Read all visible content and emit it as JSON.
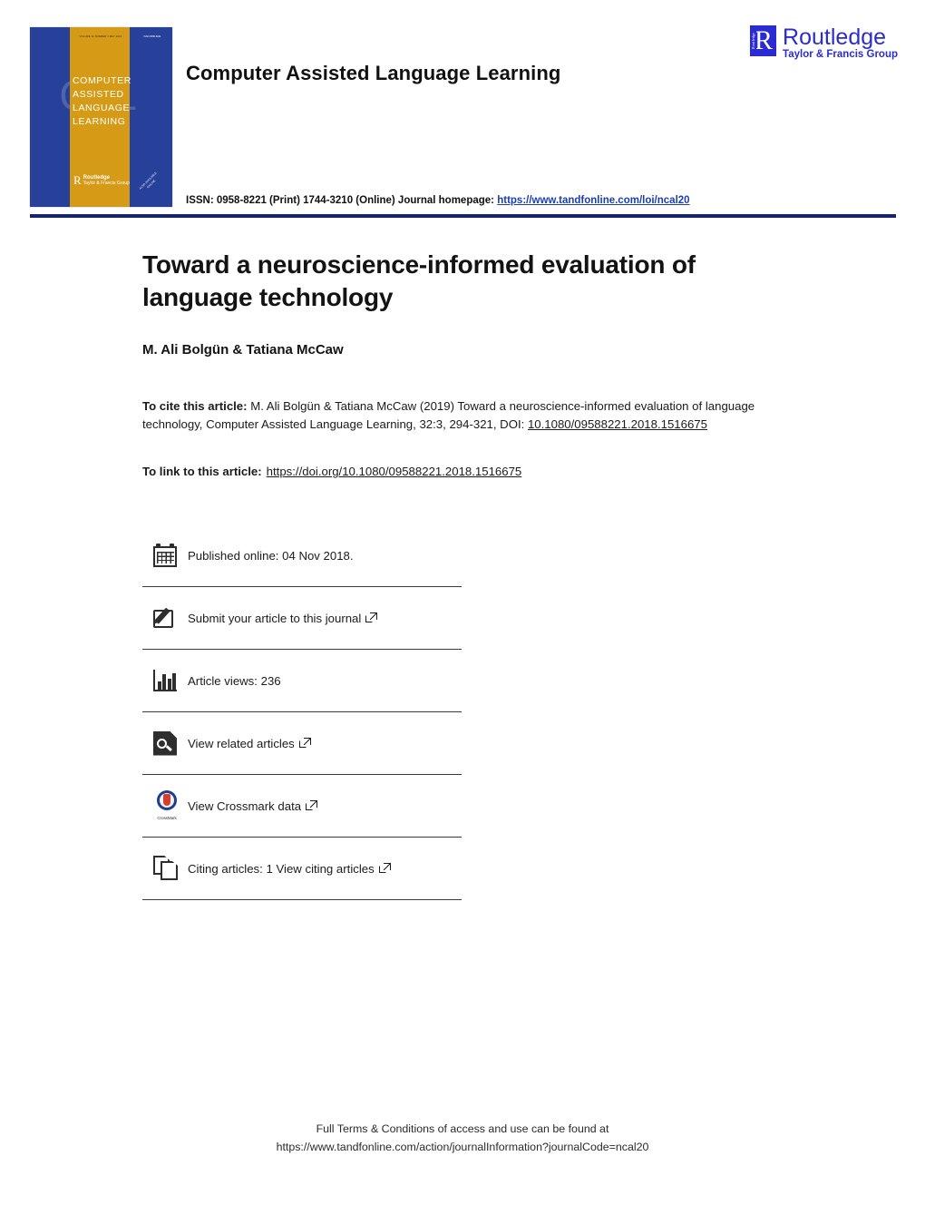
{
  "header": {
    "journal_title": "Computer Assisted Language Learning",
    "issn_prefix": "ISSN: 0958-8221 (Print) 1744-3210 (Online) Journal homepage:",
    "homepage_url": "https://www.tandfonline.com/loi/ncal20",
    "publisher": {
      "name": "Routledge",
      "tagline": "Taylor & Francis Group",
      "mark_letter": "R",
      "mark_vertical_text": "Routledge"
    },
    "cover": {
      "ghost_letters": "C L",
      "masthead": "VOLUME 32   NUMBER 3   MAY 2019",
      "issn_badge": "ISSN 0958-8221",
      "title_lines": [
        "COMPUTER",
        "ASSISTED",
        "LANGUAGE",
        "LEARNING"
      ],
      "imprint_name": "Routledge",
      "imprint_sub": "Taylor & Francis Group",
      "diagonal_lines": [
        "ALSO AVAILABLE",
        "ONLINE"
      ]
    }
  },
  "article": {
    "title": "Toward a neuroscience-informed evaluation of language technology",
    "authors": "M. Ali Bolgün & Tatiana McCaw",
    "cite": {
      "label": "To cite this article:",
      "text": " M. Ali Bolgün & Tatiana McCaw (2019) Toward a neuroscience-informed evaluation of language technology, Computer Assisted Language Learning, 32:3, 294-321, DOI: ",
      "doi": "10.1080/09588221.2018.1516675"
    },
    "link": {
      "label": "To link to this article:",
      "url": "https://doi.org/10.1080/09588221.2018.1516675"
    }
  },
  "actions": [
    {
      "icon": "calendar-icon",
      "label": "Published online: 04 Nov 2018.",
      "external": false
    },
    {
      "icon": "submit-icon",
      "label": "Submit your article to this journal",
      "external": true
    },
    {
      "icon": "bar-chart-icon",
      "label": "Article views: 236",
      "external": false
    },
    {
      "icon": "related-articles-icon",
      "label": "View related articles",
      "external": true
    },
    {
      "icon": "crossmark-icon",
      "label": "View Crossmark data",
      "external": true
    },
    {
      "icon": "citing-articles-icon",
      "label": "Citing articles: 1 View citing articles",
      "external": true
    }
  ],
  "footer": {
    "line1": "Full Terms & Conditions of access and use can be found at",
    "line2": "https://www.tandfonline.com/action/journalInformation?journalCode=ncal20"
  },
  "colors": {
    "rule": "#16256b",
    "cover_blue": "#27409a",
    "cover_gold": "#d59a16",
    "link": "#1a3fb0",
    "routledge_blue": "#2b2bd4"
  }
}
